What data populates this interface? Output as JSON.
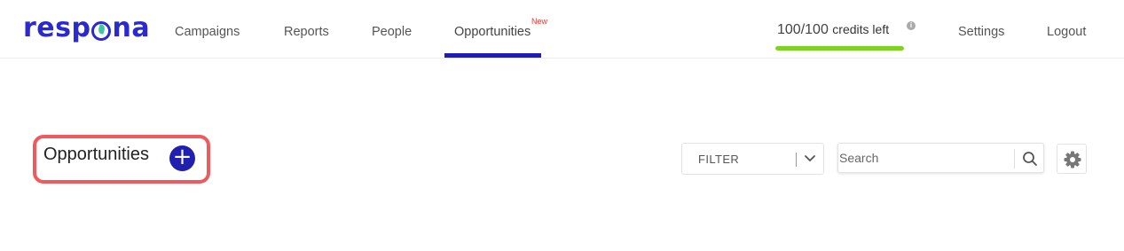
{
  "brand": {
    "logo_pre": "resp",
    "logo_post": "na"
  },
  "nav": {
    "campaigns": "Campaigns",
    "reports": "Reports",
    "people": "People",
    "opportunities": "Opportunities",
    "opportunities_badge": "New",
    "settings": "Settings",
    "logout": "Logout"
  },
  "credits": {
    "value": "100/100",
    "label": "credits left",
    "info_icon": "info-icon",
    "fraction_used_bar": 1.0,
    "bar_color": "#7ed321"
  },
  "page": {
    "title": "Opportunities",
    "add_icon": "plus-icon",
    "highlight_color": "#ef5a5f"
  },
  "toolbar": {
    "filter_label": "FILTER",
    "filter_icon": "chevron-down-icon",
    "search_placeholder": "Search",
    "search_icon": "magnifier-icon",
    "settings_icon": "gear-icon"
  },
  "colors": {
    "accent": "#1e1eb4",
    "badge": "#e53935"
  }
}
